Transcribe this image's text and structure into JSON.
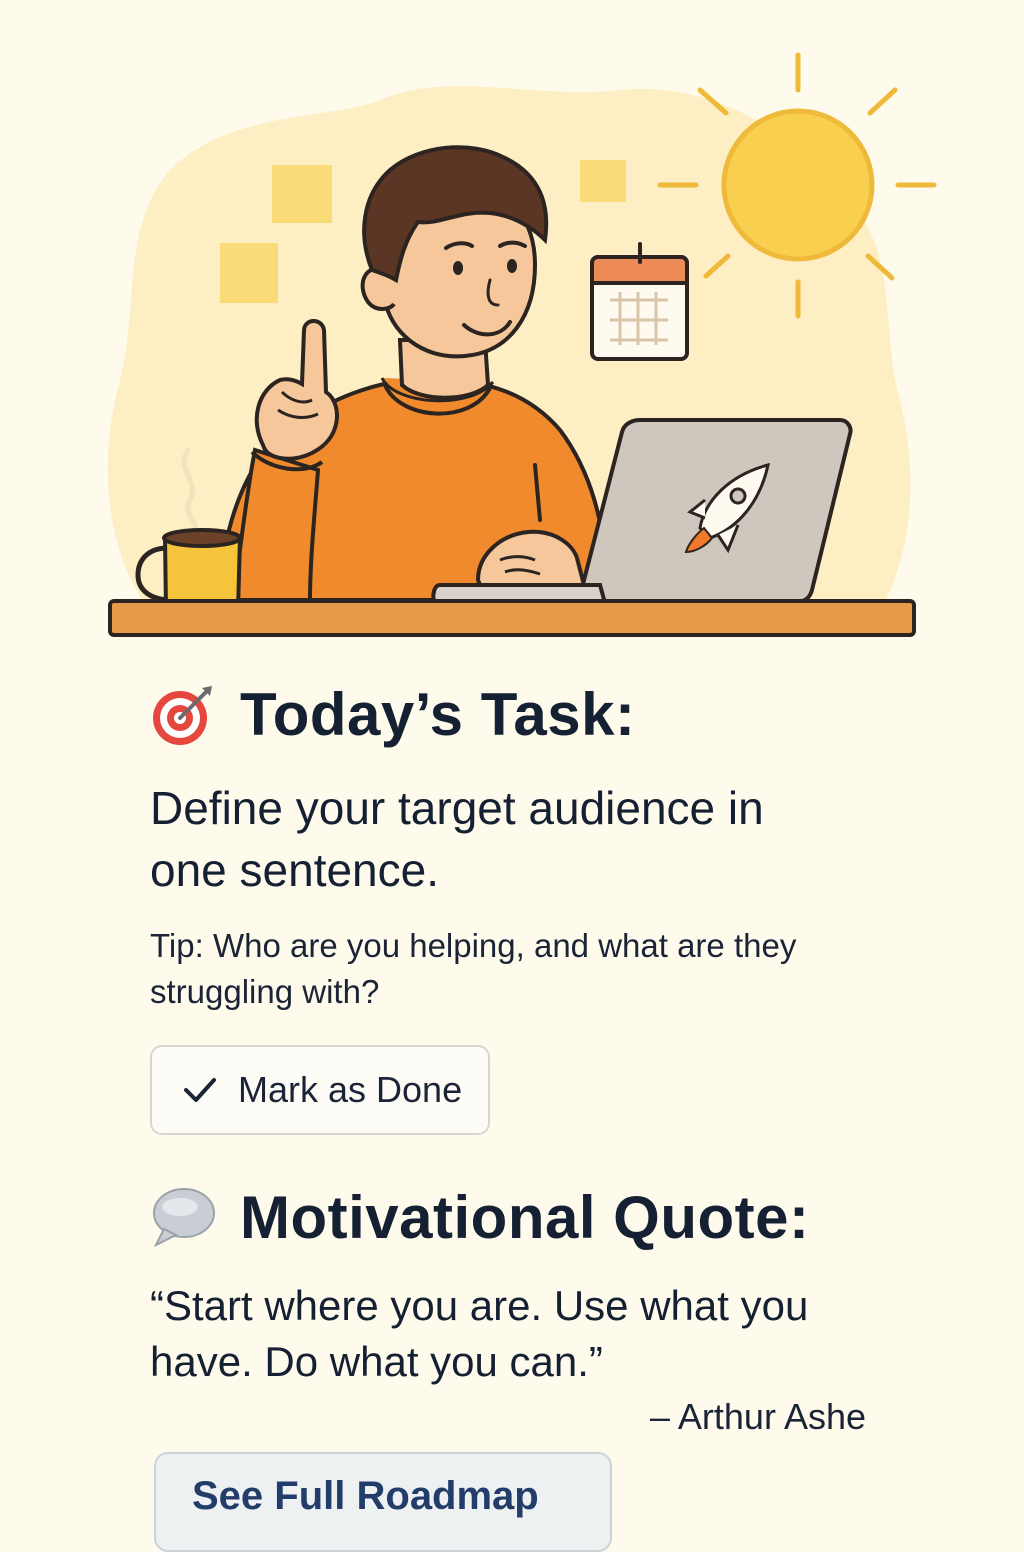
{
  "hero": {
    "illustration": "person-at-laptop-with-coffee-sun-calendar",
    "colors": {
      "background": "#fffbec",
      "blob": "#fdeec4",
      "sweater": "#f08a2c",
      "sun": "#f9cf4f",
      "laptop": "#cfc6bd",
      "desk": "#e89a4a",
      "mug": "#f6c43a"
    }
  },
  "task": {
    "icon": "target-icon",
    "title": "Today’s Task:",
    "body": "Define your target audience in one sentence.",
    "tip": "Tip: Who are you helping, and what are they struggling with?",
    "done_button": {
      "icon": "checkmark-icon",
      "label": "Mark as Done"
    }
  },
  "quote": {
    "icon": "speech-bubble-icon",
    "title": "Motivational Quote:",
    "text": "“Start where you are. Use what you have. Do what you can.”",
    "author": "– Arthur Ashe"
  },
  "roadmap_button": {
    "label": "See Full Roadmap"
  },
  "colors": {
    "text": "#152033",
    "button_text": "#233d6b",
    "button_bg": "#eef1f1",
    "accent_red": "#e5463d"
  }
}
